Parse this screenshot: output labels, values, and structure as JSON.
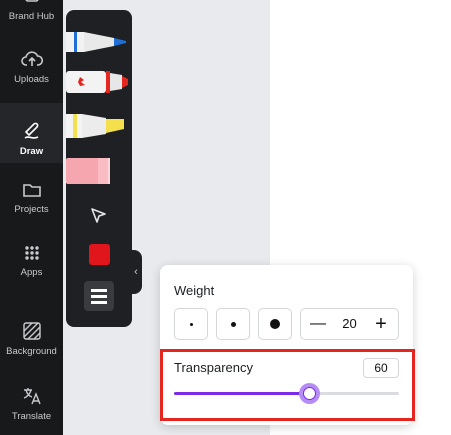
{
  "sidebar": {
    "items": [
      {
        "label": "Brand Hub",
        "icon": "brand-hub-icon"
      },
      {
        "label": "Uploads",
        "icon": "cloud-upload-icon"
      },
      {
        "label": "Draw",
        "icon": "draw-icon",
        "active": true
      },
      {
        "label": "Projects",
        "icon": "folder-icon"
      },
      {
        "label": "Apps",
        "icon": "grid-icon"
      },
      {
        "label": "Background",
        "icon": "background-pattern-icon"
      },
      {
        "label": "Translate",
        "icon": "translate-icon"
      }
    ]
  },
  "draw_tools": {
    "pens": [
      {
        "name": "pen",
        "color": "#1e6fd9"
      },
      {
        "name": "marker",
        "color": "#e5261e"
      },
      {
        "name": "highlighter",
        "color": "#f4e04d"
      },
      {
        "name": "eraser",
        "color": "#f6a6ae"
      }
    ],
    "select_icon": "cursor-arrow-icon",
    "current_color": "#e0161c",
    "settings_icon": "menu-lines-icon",
    "collapse_icon": "chevron-left-icon",
    "collapse_glyph": "‹"
  },
  "settings": {
    "weight_label": "Weight",
    "weight_presets": [
      "small",
      "medium",
      "large"
    ],
    "weight_value": "20",
    "minus_glyph": "—",
    "plus_glyph": "+",
    "transparency_label": "Transparency",
    "transparency_value": "60",
    "transparency_fraction": 0.6
  },
  "colors": {
    "accent": "#7d2ae8",
    "highlight": "#e5261e"
  }
}
